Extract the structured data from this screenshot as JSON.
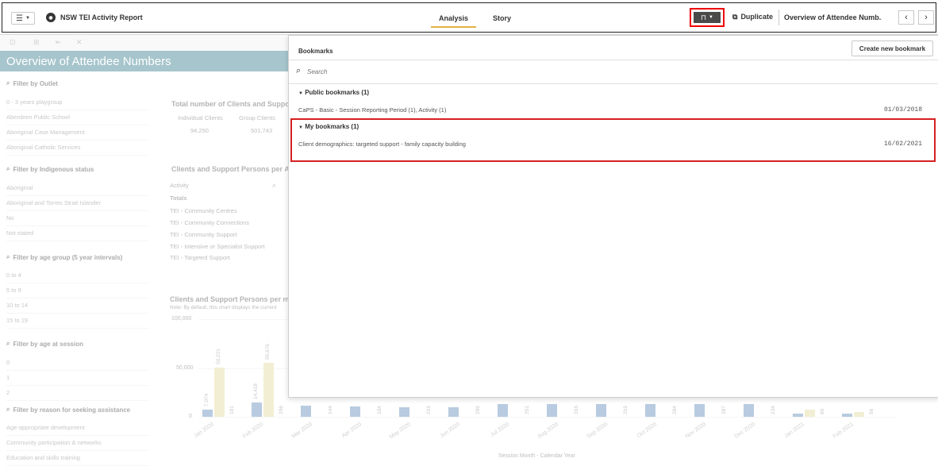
{
  "topbar": {
    "app_title": "NSW TEI Activity Report",
    "tabs": [
      "Analysis",
      "Story"
    ],
    "duplicate_label": "Duplicate",
    "sheet_selector": "Overview of Attendee Numb..."
  },
  "left": {
    "sheet_title": "Overview of Attendee Numbers",
    "filters": [
      {
        "title": "Filter by Outlet",
        "items": [
          "0 - 3 years playgroup",
          "Aberdeen Public School",
          "Aboriginal Case Management",
          "Aboriginal Catholic Services"
        ]
      },
      {
        "title": "Filter by Indigenous status",
        "items": [
          "Aboriginal",
          "Aboriginal and Torres Strait Islander",
          "No",
          "Not stated"
        ]
      },
      {
        "title": "Filter by age group (5 year intervals)",
        "items": [
          "0 to 4",
          "5 to 9",
          "10 to 14",
          "15 to 19"
        ]
      },
      {
        "title": "Filter by age at session",
        "items": [
          "0",
          "1",
          "2"
        ]
      },
      {
        "title": "Filter by reason for seeking assistance",
        "items": [
          "Age-appropriate development",
          "Community participation & networks",
          "Education and skills training"
        ]
      }
    ],
    "kpi": {
      "title": "Total number of Clients and Suppor",
      "col1_label": "Individual Clients",
      "col2_label": "Group Clients",
      "col1_value": "94,250",
      "col2_value": "501,743"
    },
    "activity_table": {
      "title": "Clients and Support Persons per Ac",
      "header": "Activity",
      "totals": "Totals",
      "rows": [
        "TEI - Community Centres",
        "TEI - Community Connections",
        "TEI - Community Support",
        "TEI - Intensive or Specialist Support",
        "TEI - Targeted Support"
      ]
    },
    "chart": {
      "title": "Clients and Support Persons per mor",
      "note": "Note: By default, this chart displays the current",
      "y_ticks": [
        "100,000",
        "50,000",
        "0"
      ],
      "x_axis_title": "Session Month - Calendar Year"
    }
  },
  "chart_data": {
    "type": "bar",
    "categories": [
      "Jan 2020",
      "Feb 2020",
      "Mar 2020",
      "Apr 2020",
      "May 2020",
      "Jun 2020",
      "Jul 2020",
      "Aug 2020",
      "Sep 2020",
      "Oct 2020",
      "Nov 2020",
      "Dec 2020",
      "Jan 2021",
      "Feb 2021"
    ],
    "series": [
      {
        "values": [
          7074,
          14418,
          null,
          null,
          null,
          null,
          null,
          null,
          null,
          null,
          null,
          null,
          null,
          null
        ],
        "color": "#7fa1c6"
      },
      {
        "values": [
          50221,
          55676,
          null,
          null,
          null,
          null,
          null,
          null,
          null,
          null,
          null,
          null,
          null,
          null
        ],
        "color": "#e8e1b0"
      },
      {
        "values": [
          181,
          206,
          144,
          184,
          219,
          286,
          251,
          316,
          319,
          284,
          387,
          234,
          86,
          56
        ],
        "color": "#bbbbbb"
      }
    ],
    "ylim": [
      0,
      100000
    ]
  },
  "bookmarks": {
    "panel_title": "Bookmarks",
    "create_label": "Create new bookmark",
    "search_placeholder": "Search",
    "public_group": "Public bookmarks (1)",
    "public_items": [
      {
        "name": "CaPS - Basic - Session Reporting Period (1), Activity (1)",
        "date": "01/03/2018"
      }
    ],
    "my_group": "My bookmarks (1)",
    "my_items": [
      {
        "name": "Client demographics: targeted support - family capacity building",
        "date": "16/02/2021"
      }
    ]
  }
}
